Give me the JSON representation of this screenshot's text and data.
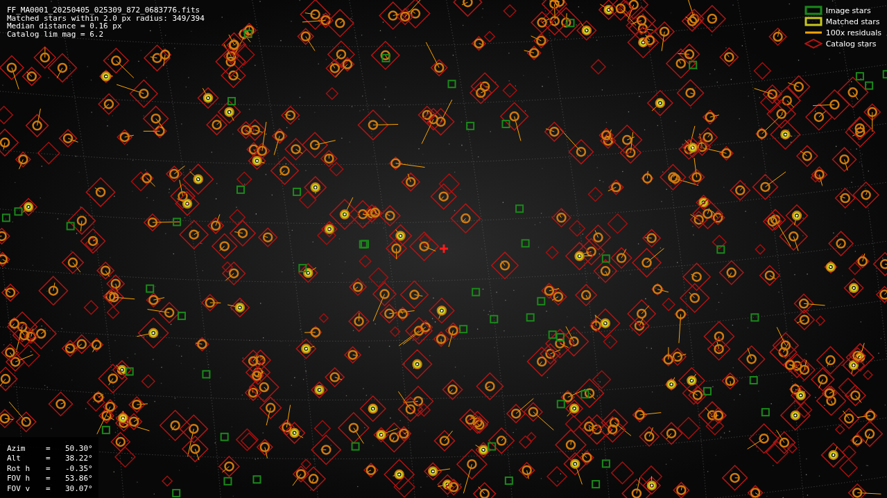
{
  "header_lines": [
    "FF_MA0001_20250405_025309_872_0683776.fits",
    "Matched stars within 2.0 px radius: 349/394",
    "Median distance = 0.16 px",
    "Catalog lim mag = 6.2"
  ],
  "legend": [
    {
      "label": "Image stars",
      "kind": "square",
      "color": "#1a8a1a"
    },
    {
      "label": "Matched stars",
      "kind": "square",
      "color": "#c8c81e"
    },
    {
      "label": "100x residuals",
      "kind": "line",
      "color": "#ffa500"
    },
    {
      "label": "Catalog stars",
      "kind": "diamond",
      "color": "#b01515"
    }
  ],
  "pointing": [
    {
      "label": "Azim",
      "sign": "=",
      "value": "50.30°"
    },
    {
      "label": "Alt",
      "sign": "=",
      "value": "38.22°"
    },
    {
      "label": "Rot h",
      "sign": "=",
      "value": "-0.35°"
    },
    {
      "label": "FOV h",
      "sign": "=",
      "value": "53.86°"
    },
    {
      "label": "FOV v",
      "sign": "=",
      "value": "30.07°"
    }
  ]
}
